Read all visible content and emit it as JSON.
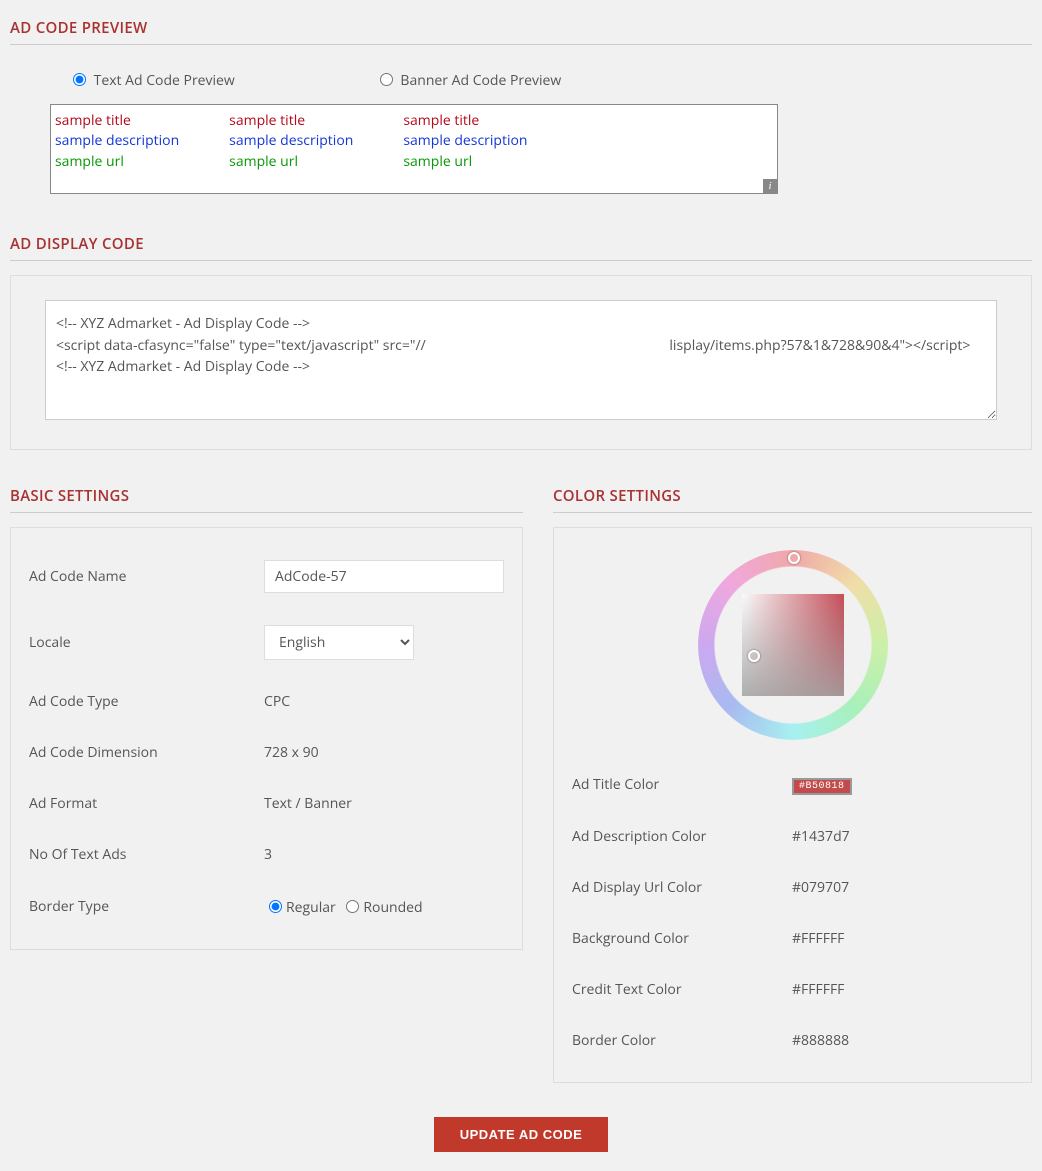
{
  "sections": {
    "preview_title": "AD CODE PREVIEW",
    "display_code_title": "AD DISPLAY CODE",
    "basic_title": "BASIC SETTINGS",
    "color_title": "COLOR SETTINGS"
  },
  "preview": {
    "radio_text": "Text Ad Code Preview",
    "radio_banner": "Banner Ad Code Preview",
    "ads": [
      {
        "title": "sample title",
        "desc": "sample description",
        "url": "sample url"
      },
      {
        "title": "sample title",
        "desc": "sample description",
        "url": "sample url"
      },
      {
        "title": "sample title",
        "desc": "sample description",
        "url": "sample url"
      }
    ]
  },
  "display_code": "<!-- XYZ Admarket - Ad Display Code -->\n<script data-cfasync=\"false\" type=\"text/javascript\" src=\"//                                                                   lisplay/items.php?57&1&728&90&4\"></script>\n<!-- XYZ Admarket - Ad Display Code -->",
  "basic": {
    "labels": {
      "name": "Ad Code Name",
      "locale": "Locale",
      "type": "Ad Code Type",
      "dimension": "Ad Code Dimension",
      "format": "Ad Format",
      "num_ads": "No Of Text Ads",
      "border": "Border Type",
      "border_regular": "Regular",
      "border_rounded": "Rounded"
    },
    "values": {
      "name": "AdCode-57",
      "locale": "English",
      "type": "CPC",
      "dimension": "728 x 90",
      "format": "Text / Banner",
      "num_ads": "3"
    }
  },
  "colors": {
    "labels": {
      "title": "Ad Title Color",
      "desc": "Ad Description Color",
      "url": "Ad Display Url Color",
      "bg": "Background Color",
      "credit": "Credit Text Color",
      "border": "Border Color"
    },
    "values": {
      "title": "#B50818",
      "desc": "#1437d7",
      "url": "#079707",
      "bg": "#FFFFFF",
      "credit": "#FFFFFF",
      "border": "#888888"
    }
  },
  "button_label": "UPDATE AD CODE"
}
